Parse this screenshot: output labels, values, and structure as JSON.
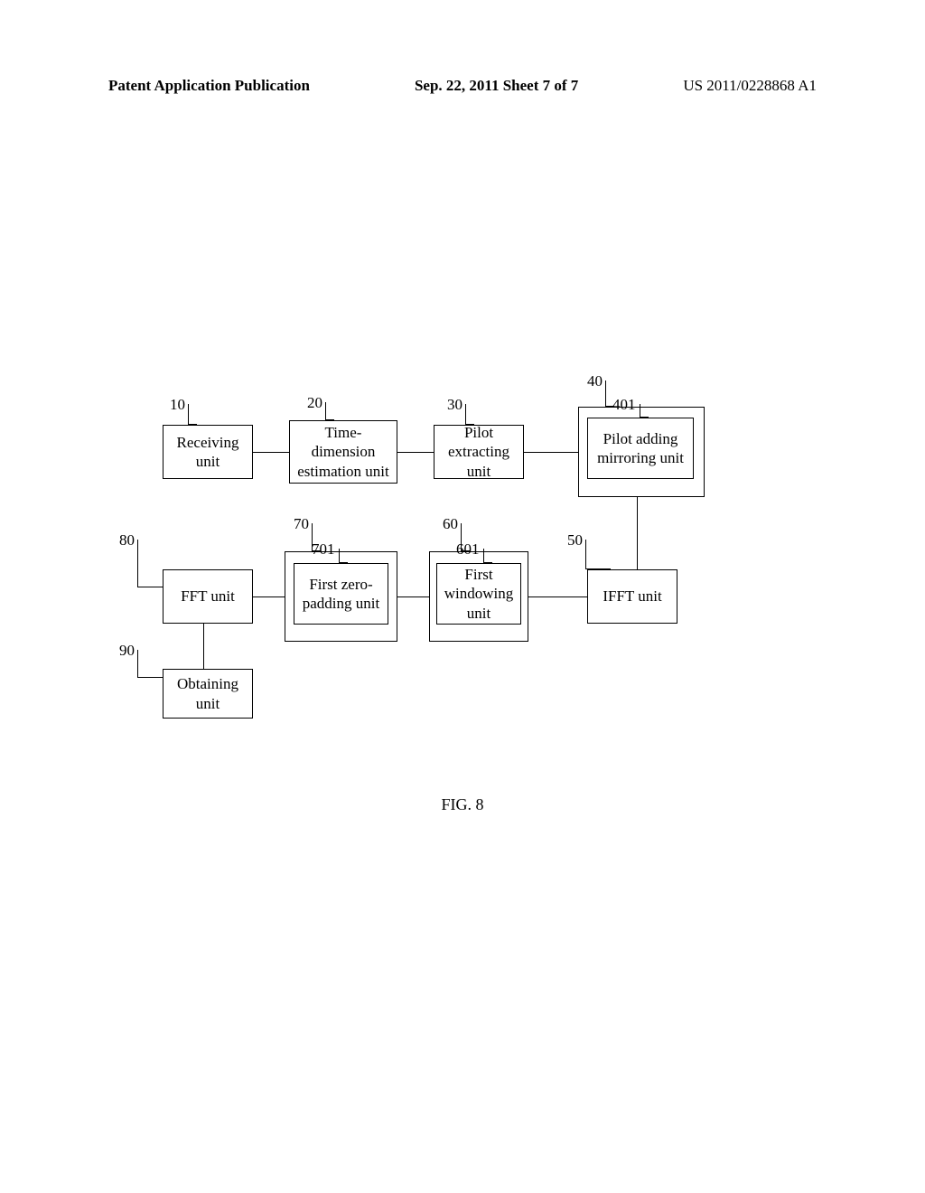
{
  "header": {
    "left": "Patent Application Publication",
    "center": "Sep. 22, 2011  Sheet 7 of 7",
    "right": "US 2011/0228868 A1"
  },
  "labels": {
    "l10": "10",
    "l20": "20",
    "l30": "30",
    "l40": "40",
    "l401": "401",
    "l50": "50",
    "l60": "60",
    "l601": "601",
    "l70": "70",
    "l701": "701",
    "l80": "80",
    "l90": "90"
  },
  "boxes": {
    "b10": "Receiving unit",
    "b20": "Time-dimension estimation unit",
    "b30": "Pilot extracting unit",
    "b401": "Pilot adding mirroring unit",
    "b50": "IFFT unit",
    "b601": "First windowing unit",
    "b701": "First zero-padding unit",
    "b80": "FFT unit",
    "b90": "Obtaining unit"
  },
  "caption": "FIG. 8"
}
